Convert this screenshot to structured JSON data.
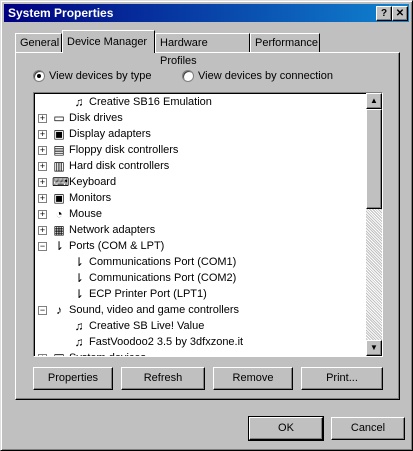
{
  "window": {
    "title": "System Properties",
    "help_glyph": "?",
    "close_glyph": "✕"
  },
  "tabs": [
    {
      "label": "General",
      "active": false
    },
    {
      "label": "Device Manager",
      "active": true
    },
    {
      "label": "Hardware Profiles",
      "active": false
    },
    {
      "label": "Performance",
      "active": false
    }
  ],
  "view_options": {
    "by_type": {
      "label": "View devices by type",
      "selected": true
    },
    "by_connection": {
      "label": "View devices by connection",
      "selected": false
    }
  },
  "device_tree": [
    {
      "label": "Creative SB16 Emulation",
      "level": 1,
      "icon": "audio-device-icon"
    },
    {
      "label": "Disk drives",
      "level": 0,
      "expanded": false,
      "icon": "disk-drive-icon"
    },
    {
      "label": "Display adapters",
      "level": 0,
      "expanded": false,
      "icon": "monitor-icon"
    },
    {
      "label": "Floppy disk controllers",
      "level": 0,
      "expanded": false,
      "icon": "floppy-controller-icon"
    },
    {
      "label": "Hard disk controllers",
      "level": 0,
      "expanded": false,
      "icon": "hard-disk-controller-icon"
    },
    {
      "label": "Keyboard",
      "level": 0,
      "expanded": false,
      "icon": "keyboard-icon"
    },
    {
      "label": "Monitors",
      "level": 0,
      "expanded": false,
      "icon": "monitor-icon"
    },
    {
      "label": "Mouse",
      "level": 0,
      "expanded": false,
      "icon": "mouse-icon"
    },
    {
      "label": "Network adapters",
      "level": 0,
      "expanded": false,
      "icon": "network-adapter-icon"
    },
    {
      "label": "Ports (COM & LPT)",
      "level": 0,
      "expanded": true,
      "icon": "port-icon"
    },
    {
      "label": "Communications Port (COM1)",
      "level": 1,
      "icon": "port-icon"
    },
    {
      "label": "Communications Port (COM2)",
      "level": 1,
      "icon": "port-icon"
    },
    {
      "label": "ECP Printer Port (LPT1)",
      "level": 1,
      "icon": "port-icon"
    },
    {
      "label": "Sound, video and game controllers",
      "level": 0,
      "expanded": true,
      "icon": "sound-controller-icon"
    },
    {
      "label": "Creative SB Live! Value",
      "level": 1,
      "icon": "audio-device-icon"
    },
    {
      "label": "FastVoodoo2 3.5 by 3dfxzone.it",
      "level": 1,
      "icon": "audio-device-icon"
    },
    {
      "label": "System devices",
      "level": 0,
      "expanded": false,
      "icon": "computer-icon"
    }
  ],
  "actions": {
    "properties": "Properties",
    "refresh": "Refresh",
    "remove": "Remove",
    "print": "Print..."
  },
  "dialog_buttons": {
    "ok": "OK",
    "cancel": "Cancel"
  },
  "colors": {
    "face": "#c0c0c0",
    "title_start": "#000080",
    "title_end": "#1084d0"
  },
  "icon_glyphs": {
    "audio-device-icon": "♫",
    "disk-drive-icon": "▭",
    "monitor-icon": "▣",
    "floppy-controller-icon": "▤",
    "hard-disk-controller-icon": "▥",
    "keyboard-icon": "⌨",
    "mouse-icon": "◔",
    "network-adapter-icon": "▦",
    "port-icon": "⇂",
    "sound-controller-icon": "♪",
    "computer-icon": "▣"
  }
}
